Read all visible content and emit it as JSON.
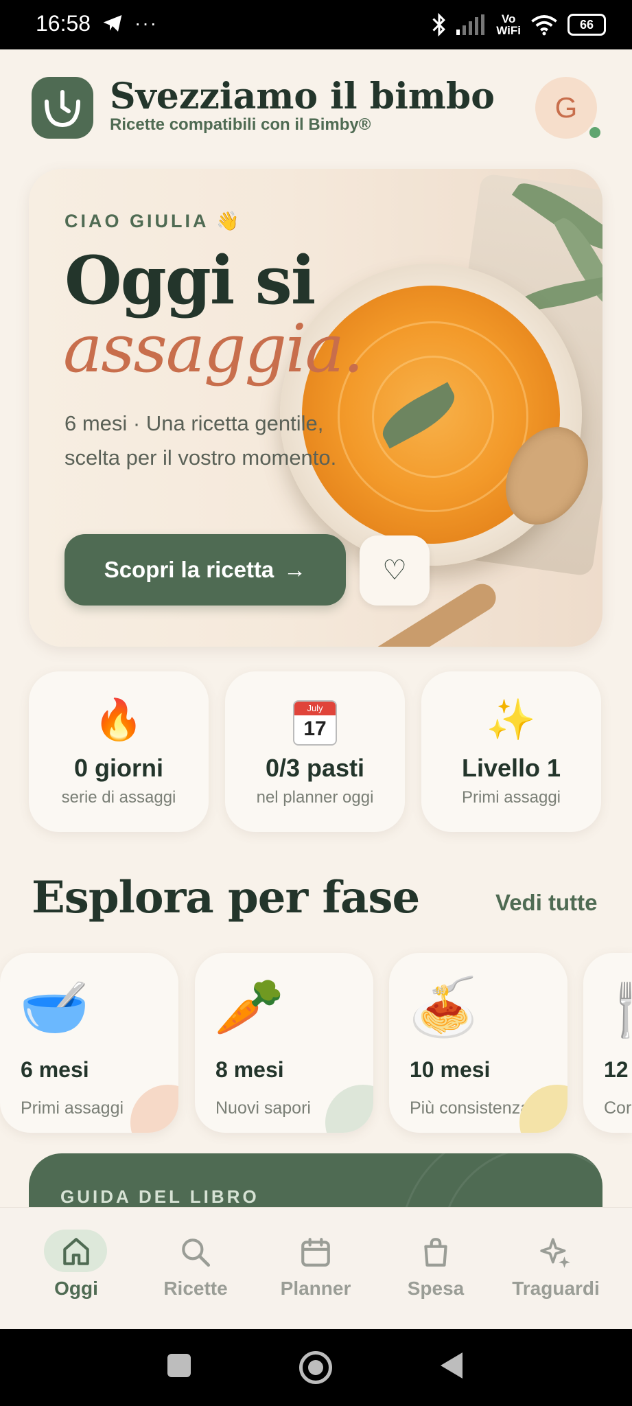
{
  "status_bar": {
    "time": "16:58",
    "left_icons": [
      "telegram-icon",
      "more-icon"
    ],
    "right_icons": [
      "bluetooth-icon",
      "signal-icon",
      "vowifi-icon",
      "wifi-icon"
    ],
    "vowifi_label": "Vo\nWiFi",
    "battery": "66"
  },
  "header": {
    "title": "Svezziamo il bimbo",
    "subtitle": "Ricette compatibili con il Bimby®",
    "avatar_initial": "G"
  },
  "hero": {
    "greeting": "CIAO GIULIA 👋",
    "title_line1": "Oggi si",
    "title_line2": "assaggia.",
    "description": "6 mesi · Una ricetta gentile, scelta per il vostro momento.",
    "cta_label": "Scopri la ricetta",
    "cta_arrow": "→",
    "favorite_glyph": "♡"
  },
  "stats": [
    {
      "icon": "🔥",
      "value": "0 giorni",
      "label": "serie di assaggi"
    },
    {
      "icon_month": "July",
      "icon_day": "17",
      "value": "0/3 pasti",
      "label": "nel planner oggi"
    },
    {
      "icon": "✨",
      "value": "Livello 1",
      "label": "Primi assaggi"
    }
  ],
  "section": {
    "title": "Esplora per fase",
    "link": "Vedi tutte"
  },
  "phases": [
    {
      "icon": "🥣",
      "title": "6 mesi",
      "subtitle": "Primi assaggi",
      "blob_color": "#F6D9C7"
    },
    {
      "icon": "🥕",
      "title": "8 mesi",
      "subtitle": "Nuovi sapori",
      "blob_color": "#DDE6D9"
    },
    {
      "icon": "🍝",
      "title": "10 mesi",
      "subtitle": "Più consistenza",
      "blob_color": "#F4E3A8"
    },
    {
      "icon": "🍴",
      "title": "12",
      "subtitle": "Cor",
      "blob_color": "#E8E1D6"
    }
  ],
  "guide": {
    "label": "GUIDA DEL LIBRO"
  },
  "bottom_nav": [
    {
      "label": "Oggi",
      "icon": "home-icon",
      "active": true
    },
    {
      "label": "Ricette",
      "icon": "search-icon",
      "active": false
    },
    {
      "label": "Planner",
      "icon": "calendar-icon",
      "active": false
    },
    {
      "label": "Spesa",
      "icon": "bag-icon",
      "active": false
    },
    {
      "label": "Traguardi",
      "icon": "sparkle-icon",
      "active": false
    }
  ],
  "colors": {
    "primary": "#4F6B53",
    "accent": "#C86E4C",
    "background": "#F8F2EA",
    "text_dark": "#23352B"
  }
}
